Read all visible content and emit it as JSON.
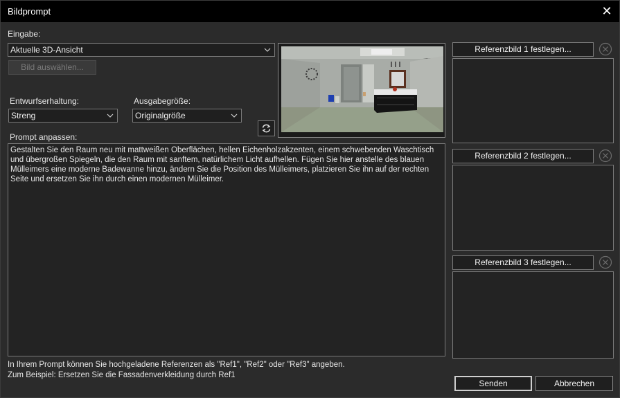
{
  "window": {
    "title": "Bildprompt"
  },
  "input": {
    "label": "Eingabe:",
    "source_value": "Aktuelle 3D-Ansicht",
    "select_image_label": "Bild auswählen..."
  },
  "design": {
    "retention_label": "Entwurfserhaltung:",
    "retention_value": "Streng",
    "output_size_label": "Ausgabegröße:",
    "output_size_value": "Originalgröße"
  },
  "prompt": {
    "label": "Prompt anpassen:",
    "text": "Gestalten Sie den Raum neu mit mattweißen Oberflächen, hellen Eichenholzakzenten, einem schwebenden Waschtisch\nund übergroßen Spiegeln, die den Raum mit sanftem, natürlichem Licht aufhellen. Fügen Sie hier anstelle des blauen\nMülleimers eine moderne Badewanne hinzu, ändern Sie die Position des Mülleimers, platzieren Sie ihn auf der rechten\nSeite und ersetzen Sie ihn durch einen modernen Mülleimer."
  },
  "references": [
    {
      "label": "Referenzbild 1 festlegen..."
    },
    {
      "label": "Referenzbild 2 festlegen..."
    },
    {
      "label": "Referenzbild 3 festlegen..."
    }
  ],
  "hint": {
    "line1": "In Ihrem Prompt können Sie hochgeladene Referenzen als \"Ref1\", \"Ref2\" oder \"Ref3\" angeben.",
    "line2": "Zum Beispiel: Ersetzen Sie die Fassadenverkleidung durch Ref1"
  },
  "actions": {
    "send_label": "Senden",
    "cancel_label": "Abbrechen"
  },
  "icons": {
    "close": "close-icon",
    "chevron": "chevron-down-icon",
    "refresh": "refresh-icon",
    "clear": "clear-circle-icon"
  },
  "colors": {
    "background": "#2b2b2b",
    "titlebar": "#000000",
    "field": "#1f1f1f",
    "border": "#7a7a7a"
  }
}
